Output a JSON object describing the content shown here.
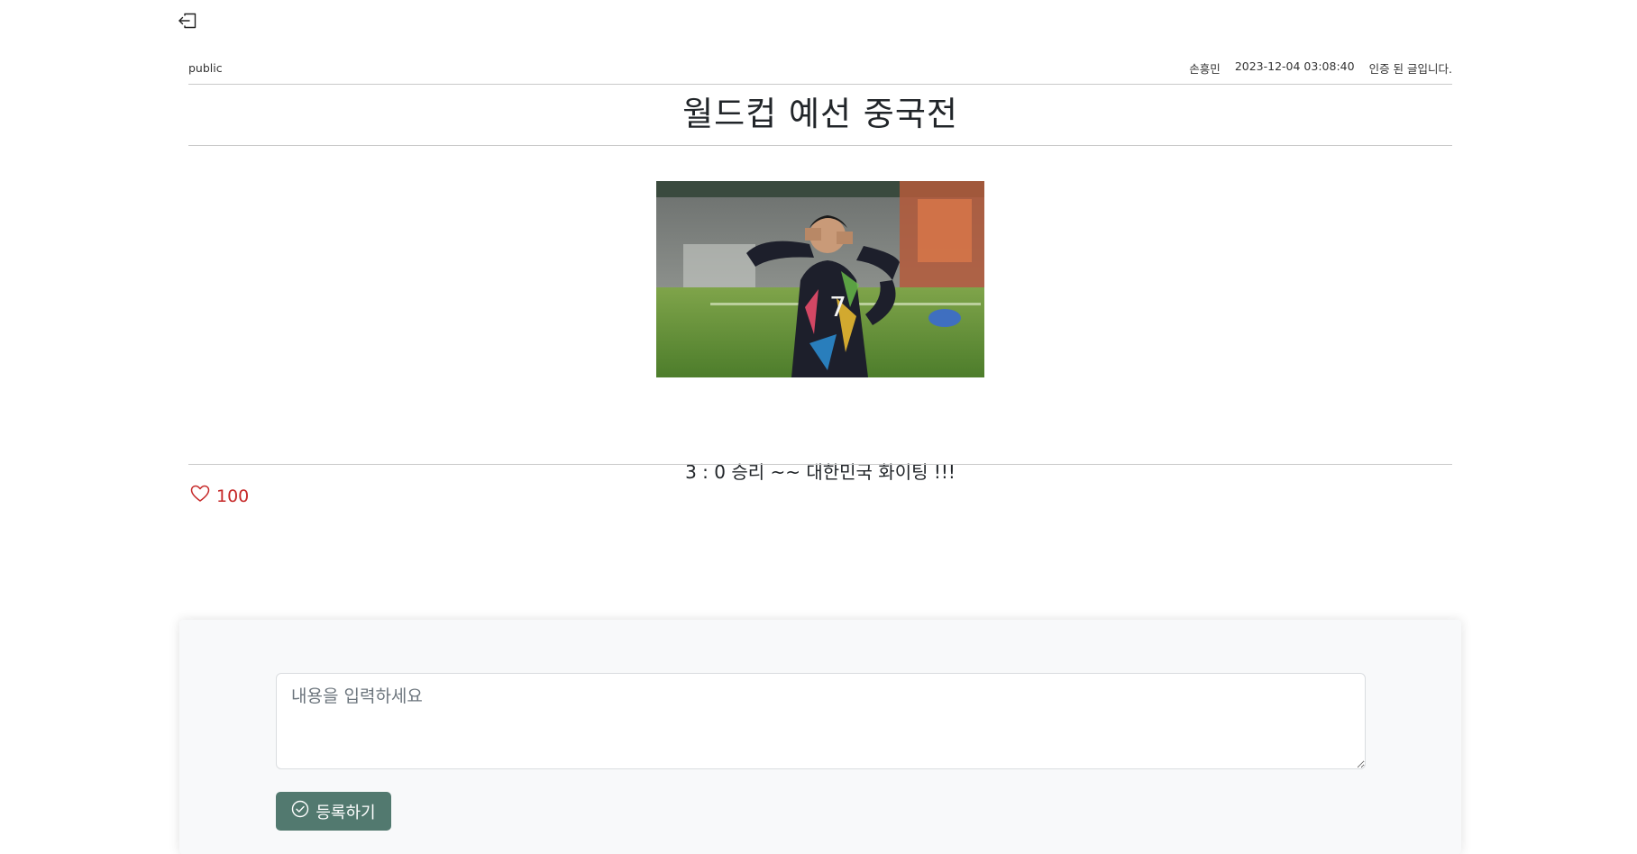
{
  "nav": {
    "back_icon": "box-arrow-in-left-icon"
  },
  "post": {
    "visibility": "public",
    "author": "손흥민",
    "datetime": "2023-12-04 03:08:40",
    "auth_status": "인증 된 글입니다.",
    "title": "월드컵 예선 중국전",
    "image_icon": "photo-soccer-player-number-7",
    "content": "3 : 0 승리 ~~ 대한민국 화이팅 !!!",
    "likes": "100",
    "like_icon": "heart-outline-icon",
    "accent_color": "#c62828"
  },
  "comment": {
    "placeholder": "내용을 입력하세요",
    "submit_label": "등록하기",
    "submit_icon": "check-circle-icon",
    "button_color": "#52796f"
  }
}
